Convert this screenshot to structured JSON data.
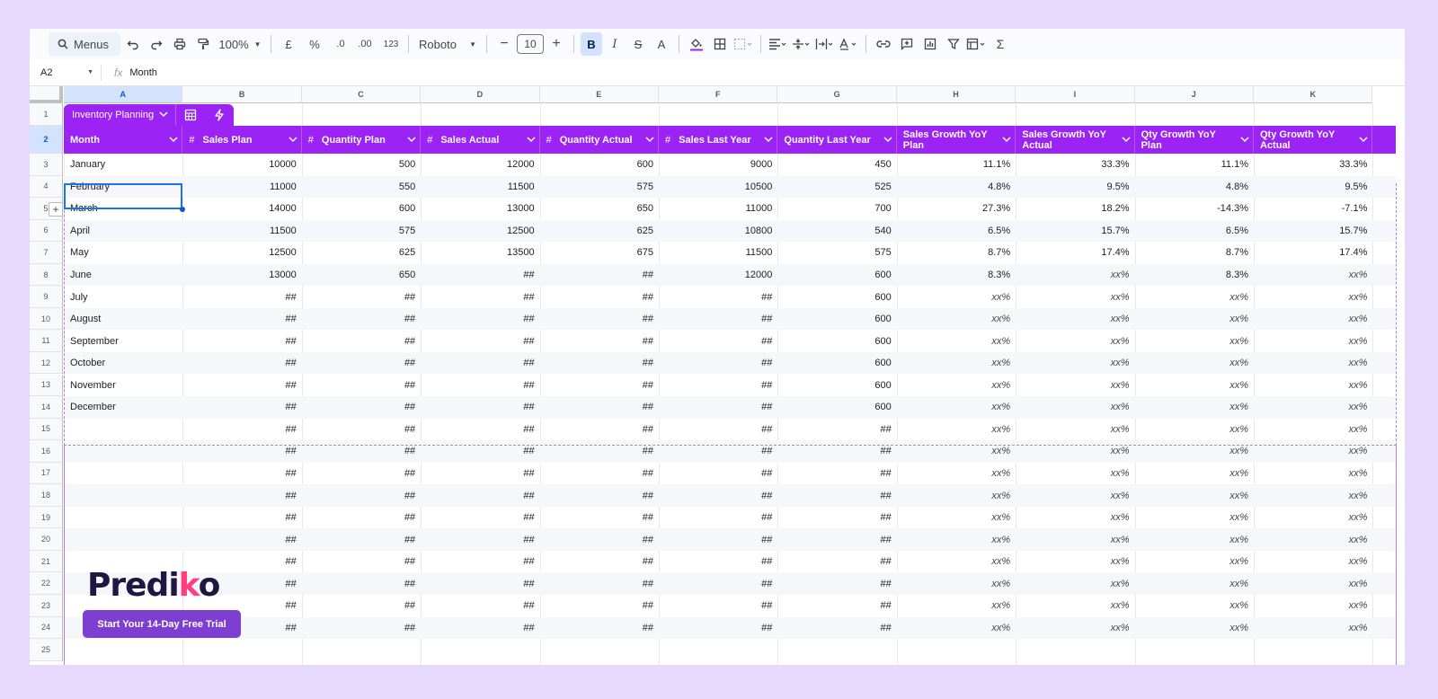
{
  "toolbar": {
    "search_label": "Menus",
    "zoom": "100%",
    "currency": "£",
    "percent": "%",
    "dec_decrease": ".0",
    "dec_increase": ".00",
    "format_number": "123",
    "font": "Roboto",
    "font_size": "10",
    "bold": "B",
    "italic": "I",
    "text_color": "A"
  },
  "formula_bar": {
    "cell_ref": "A2",
    "fx": "fx",
    "value": "Month"
  },
  "columns": [
    "A",
    "B",
    "C",
    "D",
    "E",
    "F",
    "G",
    "H",
    "I",
    "J",
    "K"
  ],
  "rows": [
    "1",
    "2",
    "3",
    "4",
    "5",
    "6",
    "7",
    "8",
    "9",
    "10",
    "11",
    "12",
    "13",
    "14",
    "15",
    "16",
    "17",
    "18",
    "19",
    "20",
    "21",
    "22",
    "23",
    "24",
    "25"
  ],
  "table": {
    "name": "Inventory Planning",
    "headers": [
      {
        "label": "Month",
        "hash": ""
      },
      {
        "label": "Sales Plan",
        "hash": "#"
      },
      {
        "label": "Quantity Plan",
        "hash": "#"
      },
      {
        "label": "Sales Actual",
        "hash": "#"
      },
      {
        "label": "Quantity Actual",
        "hash": "#"
      },
      {
        "label": "Sales Last Year",
        "hash": "#"
      },
      {
        "label": "Quantity Last Year",
        "hash": ""
      },
      {
        "label": "Sales Growth YoY Plan",
        "hash": ""
      },
      {
        "label": "Sales Growth YoY Actual",
        "hash": ""
      },
      {
        "label": "Qty Growth YoY Plan",
        "hash": ""
      },
      {
        "label": "Qty Growth YoY Actual",
        "hash": ""
      }
    ],
    "data": [
      [
        "January",
        "10000",
        "500",
        "12000",
        "600",
        "9000",
        "450",
        "11.1%",
        "33.3%",
        "11.1%",
        "33.3%"
      ],
      [
        "February",
        "11000",
        "550",
        "11500",
        "575",
        "10500",
        "525",
        "4.8%",
        "9.5%",
        "4.8%",
        "9.5%"
      ],
      [
        "March",
        "14000",
        "600",
        "13000",
        "650",
        "11000",
        "700",
        "27.3%",
        "18.2%",
        "-14.3%",
        "-7.1%"
      ],
      [
        "April",
        "11500",
        "575",
        "12500",
        "625",
        "10800",
        "540",
        "6.5%",
        "15.7%",
        "6.5%",
        "15.7%"
      ],
      [
        "May",
        "12500",
        "625",
        "13500",
        "675",
        "11500",
        "575",
        "8.7%",
        "17.4%",
        "8.7%",
        "17.4%"
      ],
      [
        "June",
        "13000",
        "650",
        "##",
        "##",
        "12000",
        "600",
        "8.3%",
        "xx%",
        "8.3%",
        "xx%"
      ],
      [
        "July",
        "##",
        "##",
        "##",
        "##",
        "##",
        "600",
        "xx%",
        "xx%",
        "xx%",
        "xx%"
      ],
      [
        "August",
        "##",
        "##",
        "##",
        "##",
        "##",
        "600",
        "xx%",
        "xx%",
        "xx%",
        "xx%"
      ],
      [
        "September",
        "##",
        "##",
        "##",
        "##",
        "##",
        "600",
        "xx%",
        "xx%",
        "xx%",
        "xx%"
      ],
      [
        "October",
        "##",
        "##",
        "##",
        "##",
        "##",
        "600",
        "xx%",
        "xx%",
        "xx%",
        "xx%"
      ],
      [
        "November",
        "##",
        "##",
        "##",
        "##",
        "##",
        "600",
        "xx%",
        "xx%",
        "xx%",
        "xx%"
      ],
      [
        "December",
        "##",
        "##",
        "##",
        "##",
        "##",
        "600",
        "xx%",
        "xx%",
        "xx%",
        "xx%"
      ],
      [
        "",
        "##",
        "##",
        "##",
        "##",
        "##",
        "##",
        "xx%",
        "xx%",
        "xx%",
        "xx%"
      ],
      [
        "",
        "##",
        "##",
        "##",
        "##",
        "##",
        "##",
        "xx%",
        "xx%",
        "xx%",
        "xx%"
      ],
      [
        "",
        "##",
        "##",
        "##",
        "##",
        "##",
        "##",
        "xx%",
        "xx%",
        "xx%",
        "xx%"
      ],
      [
        "",
        "##",
        "##",
        "##",
        "##",
        "##",
        "##",
        "xx%",
        "xx%",
        "xx%",
        "xx%"
      ],
      [
        "",
        "##",
        "##",
        "##",
        "##",
        "##",
        "##",
        "xx%",
        "xx%",
        "xx%",
        "xx%"
      ],
      [
        "",
        "##",
        "##",
        "##",
        "##",
        "##",
        "##",
        "xx%",
        "xx%",
        "xx%",
        "xx%"
      ],
      [
        "",
        "##",
        "##",
        "##",
        "##",
        "##",
        "##",
        "xx%",
        "xx%",
        "xx%",
        "xx%"
      ],
      [
        "",
        "##",
        "##",
        "##",
        "##",
        "##",
        "##",
        "xx%",
        "xx%",
        "xx%",
        "xx%"
      ],
      [
        "",
        "##",
        "##",
        "##",
        "##",
        "##",
        "##",
        "xx%",
        "xx%",
        "xx%",
        "xx%"
      ],
      [
        "",
        "##",
        "##",
        "##",
        "##",
        "##",
        "##",
        "xx%",
        "xx%",
        "xx%",
        "xx%"
      ]
    ]
  },
  "promo": {
    "logo_pre": "Predi",
    "logo_k": "k",
    "logo_post": "o",
    "cta": "Start Your 14-Day Free Trial"
  },
  "colors": {
    "table_header": "#9b24f5",
    "brand_dark": "#1f1643",
    "brand_pink": "#ff3d7f",
    "cta": "#7d3fd0",
    "selection": "#1a73e8"
  }
}
